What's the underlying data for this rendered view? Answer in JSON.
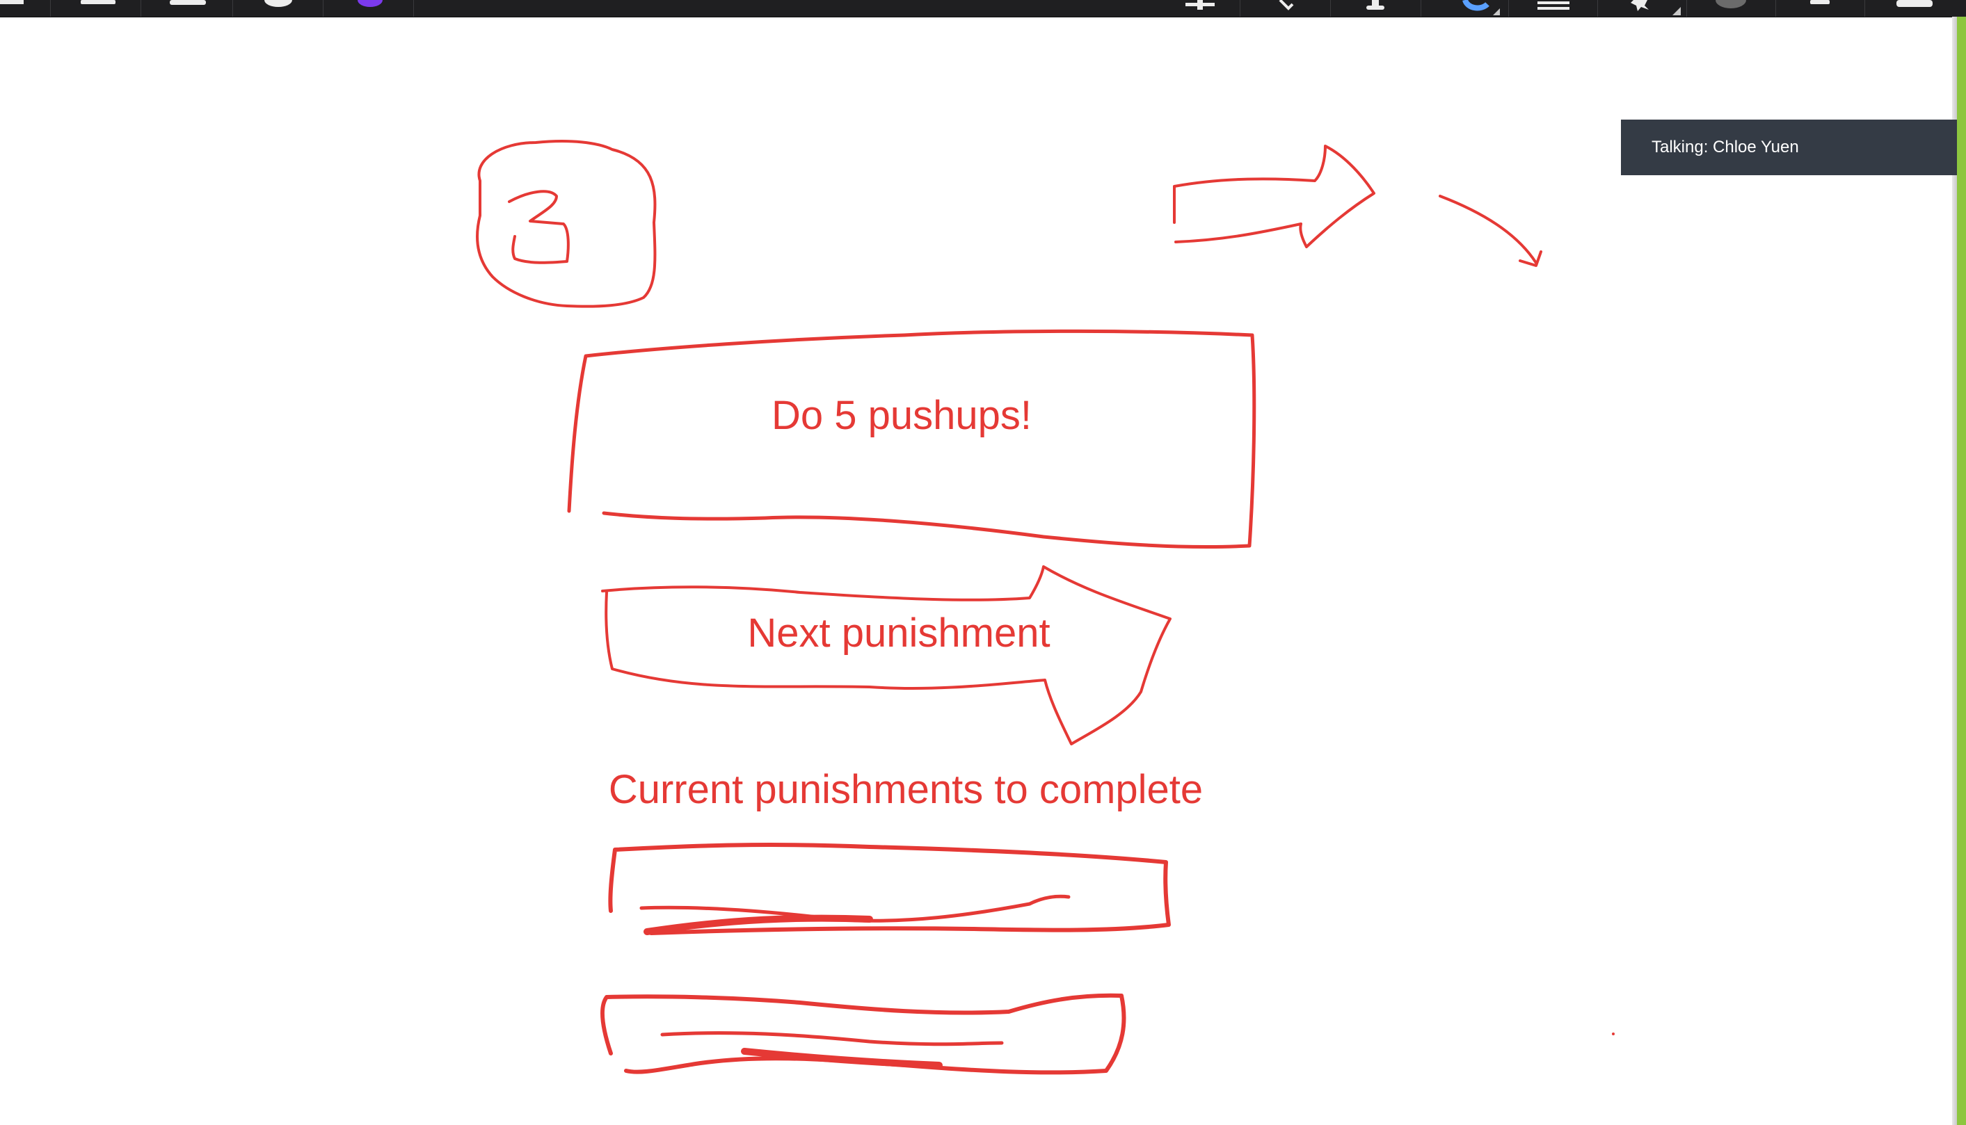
{
  "toolbar": {
    "icons": [
      "menu-icon",
      "folder-icon",
      "screen-icon",
      "clock-icon",
      "avatar-icon",
      "plus-icon",
      "cursor-icon",
      "pen-icon",
      "eraser-icon",
      "lines-icon",
      "star-icon",
      "record-icon",
      "square-icon",
      "camera-icon"
    ]
  },
  "call": {
    "talking_indicator": "Talking: Chloe Yuen"
  },
  "sketch": {
    "ink_color": "#e53935",
    "counter_label": "3",
    "punishment_text": "Do 5 pushups!",
    "next_button_label": "Next punishment",
    "list_heading": "Current punishments to complete"
  },
  "accent_color": "#8dc63f"
}
